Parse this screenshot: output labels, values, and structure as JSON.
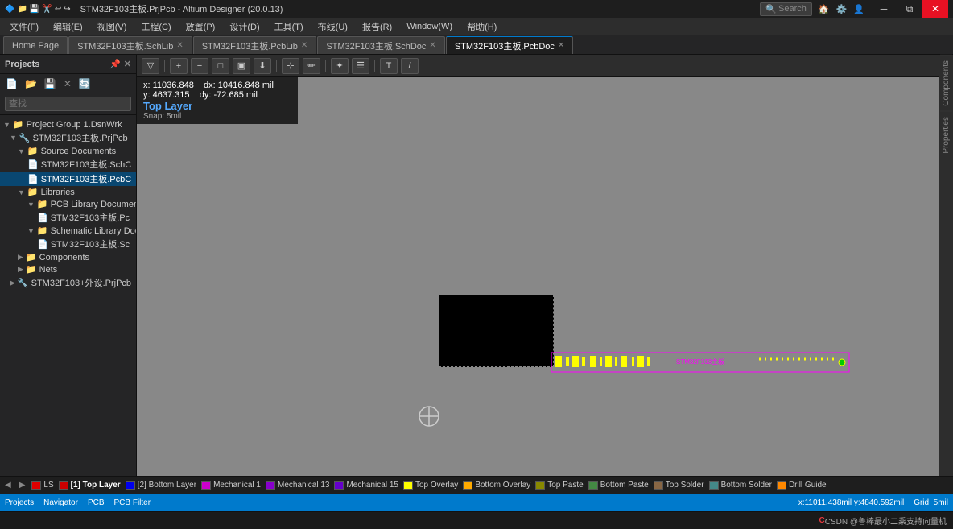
{
  "titleBar": {
    "title": "STM32F103主板.PrjPcb - Altium Designer (20.0.13)",
    "searchPlaceholder": "Search"
  },
  "menuBar": {
    "items": [
      "文件(F)",
      "编辑(E)",
      "视图(V)",
      "工程(C)",
      "放置(P)",
      "设计(D)",
      "工具(T)",
      "布线(U)",
      "报告(R)",
      "Window(W)",
      "帮助(H)"
    ]
  },
  "tabs": [
    {
      "label": "Home Page",
      "active": false,
      "closable": false
    },
    {
      "label": "STM32F103主板.SchLib",
      "active": false,
      "closable": true
    },
    {
      "label": "STM32F103主板.PcbLib",
      "active": false,
      "closable": true
    },
    {
      "label": "STM32F103主板.SchDoc",
      "active": false,
      "closable": true
    },
    {
      "label": "STM32F103主板.PcbDoc",
      "active": true,
      "closable": true
    }
  ],
  "sidebar": {
    "title": "Projects",
    "searchPlaceholder": "查找",
    "tree": [
      {
        "label": "Project Group 1.DsnWrk",
        "level": 0,
        "type": "group",
        "expanded": true
      },
      {
        "label": "STM32F103主板.PrjPcb",
        "level": 1,
        "type": "project",
        "expanded": true,
        "selected": false
      },
      {
        "label": "Source Documents",
        "level": 2,
        "type": "folder",
        "expanded": true
      },
      {
        "label": "STM32F103主板.SchC",
        "level": 3,
        "type": "file-sch"
      },
      {
        "label": "STM32F103主板.PcbC",
        "level": 3,
        "type": "file-pcb",
        "selected": true
      },
      {
        "label": "Libraries",
        "level": 2,
        "type": "folder",
        "expanded": true
      },
      {
        "label": "PCB Library Documen",
        "level": 3,
        "type": "folder",
        "expanded": true
      },
      {
        "label": "STM32F103主板.Pc",
        "level": 4,
        "type": "file-pcb"
      },
      {
        "label": "Schematic Library Doc",
        "level": 3,
        "type": "folder",
        "expanded": true
      },
      {
        "label": "STM32F103主板.Sc",
        "level": 4,
        "type": "file-sch"
      },
      {
        "label": "Components",
        "level": 2,
        "type": "folder",
        "expanded": false
      },
      {
        "label": "Nets",
        "level": 2,
        "type": "folder",
        "expanded": false
      },
      {
        "label": "STM32F103+外设.PrjPcb",
        "level": 1,
        "type": "project",
        "expanded": false
      }
    ]
  },
  "coordOverlay": {
    "x_label": "x:",
    "x_val": "11036.848",
    "dx_label": "dx:",
    "dx_val": "10416.848 mil",
    "y_label": "y:",
    "y_val": "4637.315",
    "dy_label": "dy:",
    "dy_val": "-72.685  mil",
    "layer": "Top Layer",
    "snap": "Snap: 5mil"
  },
  "layerBar": {
    "layers": [
      {
        "label": "LS",
        "color": "#e00000",
        "active": false
      },
      {
        "label": "[1] Top Layer",
        "color": "#cc0000",
        "active": true
      },
      {
        "label": "[2] Bottom Layer",
        "color": "#0000ee",
        "active": false
      },
      {
        "label": "Mechanical 1",
        "color": "#cc00cc",
        "active": false
      },
      {
        "label": "Mechanical 13",
        "color": "#8800cc",
        "active": false
      },
      {
        "label": "Mechanical 15",
        "color": "#6600cc",
        "active": false
      },
      {
        "label": "Top Overlay",
        "color": "#ffff00",
        "active": false
      },
      {
        "label": "Bottom Overlay",
        "color": "#ffaa00",
        "active": false
      },
      {
        "label": "Top Paste",
        "color": "#888800",
        "active": false
      },
      {
        "label": "Bottom Paste",
        "color": "#448844",
        "active": false
      },
      {
        "label": "Top Solder",
        "color": "#886644",
        "active": false
      },
      {
        "label": "Bottom Solder",
        "color": "#448888",
        "active": false
      },
      {
        "label": "Drill Guide",
        "color": "#ff8800",
        "active": false
      }
    ]
  },
  "statusBar": {
    "coords": "x:11011.438mil y:4840.592mil",
    "grid": "Grid: 5mil",
    "items": [
      "Projects",
      "Navigator",
      "PCB",
      "PCB Filter"
    ]
  },
  "rightSidebar": {
    "tabs": [
      "Components",
      "Properties"
    ]
  },
  "csdnBar": {
    "text": "CSDN @鲁棒最小二乘支持向量机"
  }
}
